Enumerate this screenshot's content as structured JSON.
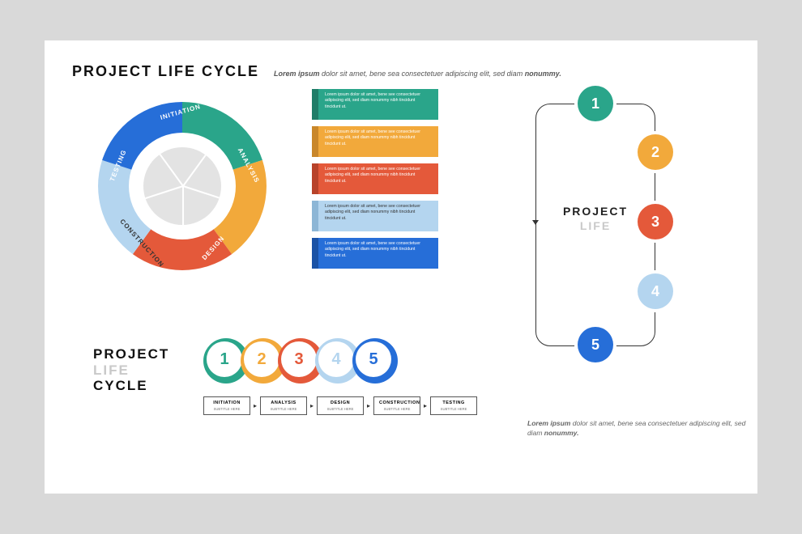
{
  "header": {
    "title": "PROJECT LIFE CYCLE",
    "subtitle_b1": "Lorem ipsum",
    "subtitle_mid": " dolor sit amet, bene sea consectetuer adipiscing elit, sed diam ",
    "subtitle_b2": "nonummy."
  },
  "colors": {
    "teal": "#2aa58a",
    "orange": "#f2a93b",
    "red": "#e4593a",
    "lightblue": "#b4d5ef",
    "blue": "#266ed8"
  },
  "wheel": {
    "labels": [
      "INITIATION",
      "ANALYSIS",
      "DESIGN",
      "CONSTRUCTION",
      "TESTING"
    ]
  },
  "boxes": {
    "text": "Lorem ipsum dolor sit amet, bene see consectetuer adipiscing elit, sed diam nonummy nibh tincidunt tincidunt ut."
  },
  "flow": {
    "title1": "PROJECT",
    "title2": "LIFE",
    "numbers": [
      "1",
      "2",
      "3",
      "4",
      "5"
    ],
    "footer_b1": "Lorem ipsum",
    "footer_mid": " dolor sit amet, bene sea consectetuer adipiscing elit, sed diam ",
    "footer_b2": "nonummy."
  },
  "bottomTitle": {
    "w1": "PROJECT",
    "w2": "LIFE",
    "w3": "CYCLE"
  },
  "dots": {
    "numbers": [
      "1",
      "2",
      "3",
      "4",
      "5"
    ]
  },
  "steps": {
    "items": [
      {
        "t": "INITIATION",
        "s": "SUBTITLE HERE"
      },
      {
        "t": "ANALYSIS",
        "s": "SUBTITLE HERE"
      },
      {
        "t": "DESIGN",
        "s": "SUBTITLE HERE"
      },
      {
        "t": "CONSTRUCTION",
        "s": "SUBTITLE HERE"
      },
      {
        "t": "TESTING",
        "s": "SUBTITLE HERE"
      }
    ]
  }
}
